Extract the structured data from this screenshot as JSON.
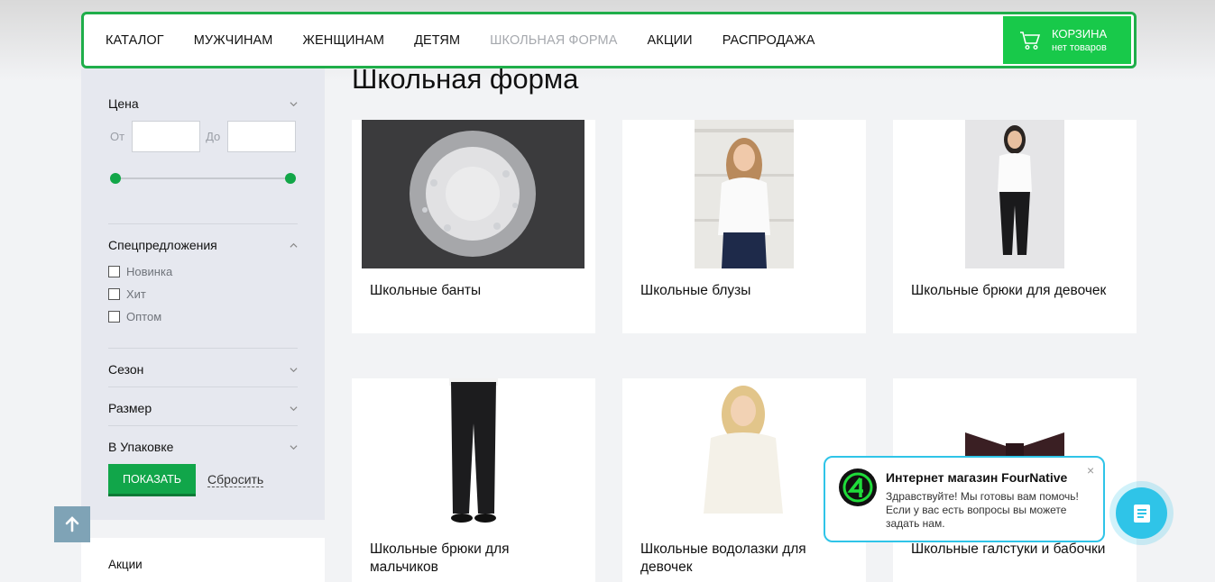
{
  "nav": {
    "items": [
      {
        "label": "КАТАЛОГ"
      },
      {
        "label": "МУЖЧИНАМ"
      },
      {
        "label": "ЖЕНЩИНАМ"
      },
      {
        "label": "ДЕТЯМ"
      },
      {
        "label": "ШКОЛЬНАЯ ФОРМА"
      },
      {
        "label": "АКЦИИ"
      },
      {
        "label": "РАСПРОДАЖА"
      }
    ],
    "active_index": 4,
    "cart": {
      "title": "КОРЗИНА",
      "subtitle": "нет товаров"
    }
  },
  "colors": {
    "accent": "#1fae4a",
    "cart_bg": "#18c94a",
    "chat": "#2fc4e8"
  },
  "filters": {
    "price": {
      "label": "Цена",
      "from_label": "От",
      "to_label": "До",
      "from_value": "",
      "to_value": ""
    },
    "special": {
      "label": "Спецпредложения",
      "options": [
        {
          "label": "Новинка",
          "checked": false
        },
        {
          "label": "Хит",
          "checked": false
        },
        {
          "label": "Оптом",
          "checked": false
        }
      ]
    },
    "season": {
      "label": "Сезон"
    },
    "size": {
      "label": "Размер"
    },
    "package": {
      "label": "В Упаковке"
    },
    "show_button": "ПОКАЗАТЬ",
    "reset_link": "Сбросить"
  },
  "sidebar_links": {
    "promo": "Акции"
  },
  "page": {
    "title": "Школьная форма"
  },
  "products": [
    {
      "name": "Школьные банты"
    },
    {
      "name": "Школьные блузы"
    },
    {
      "name": "Школьные брюки для девочек"
    },
    {
      "name": "Школьные брюки для мальчиков"
    },
    {
      "name": "Школьные водолазки для девочек"
    },
    {
      "name": "Школьные галстуки и бабочки"
    }
  ],
  "chat": {
    "title": "Интернет магазин FourNative",
    "message": "Здравствуйте! Мы готовы вам помочь! Если у вас есть вопросы вы можете задать нам.",
    "close": "×"
  }
}
